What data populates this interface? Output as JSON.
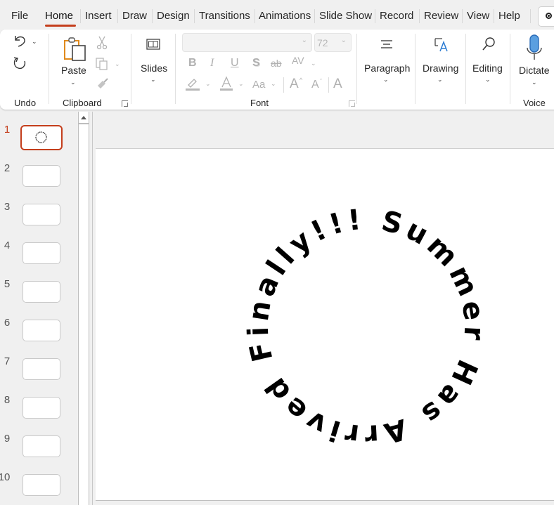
{
  "menu": {
    "tabs": [
      "File",
      "Home",
      "Insert",
      "Draw",
      "Design",
      "Transitions",
      "Animations",
      "Slide Show",
      "Record",
      "Review",
      "View",
      "Help"
    ],
    "active_tab": "Home"
  },
  "ribbon": {
    "undo": {
      "group_label": "Undo",
      "undo_icon": "undo-icon",
      "redo_icon": "redo-icon"
    },
    "clipboard": {
      "group_label": "Clipboard",
      "paste_label": "Paste",
      "icons": [
        "paste-icon",
        "cut-icon",
        "copy-icon",
        "format-painter-icon"
      ]
    },
    "slides": {
      "label": "Slides",
      "icon": "new-slide-icon"
    },
    "font": {
      "group_label": "Font",
      "font_name": "",
      "font_size": "72",
      "buttons": {
        "bold": "B",
        "italic": "I",
        "underline": "U",
        "shadow": "S",
        "strikethrough": "ab",
        "spacing": "AV",
        "change_case": "Aa",
        "grow": "A",
        "shrink": "A",
        "clear": "A"
      }
    },
    "paragraph": {
      "label": "Paragraph",
      "icon": "paragraph-icon"
    },
    "drawing": {
      "label": "Drawing",
      "icon": "drawing-icon"
    },
    "editing": {
      "label": "Editing",
      "icon": "search-icon"
    },
    "voice": {
      "group_label": "Voice",
      "dictate_label": "Dictate",
      "icon": "microphone-icon"
    },
    "accent_color": "#c43e1c"
  },
  "slides_panel": {
    "selected": 1,
    "slides": [
      "1",
      "2",
      "3",
      "4",
      "5",
      "6",
      "7",
      "8",
      "9",
      "10"
    ]
  },
  "slide": {
    "wordart_text": "Summer Has Arrived Finally!!!",
    "text_effect": "circle"
  }
}
